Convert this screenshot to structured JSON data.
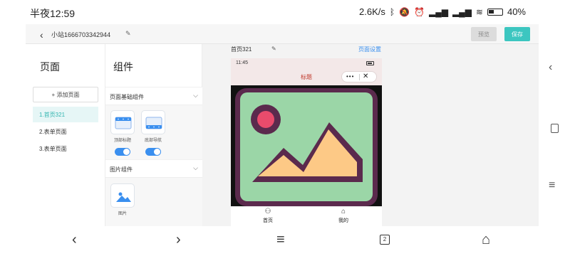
{
  "status_bar": {
    "time": "半夜12:59",
    "network_speed": "2.6K/s",
    "battery": "40%"
  },
  "topbar": {
    "site_name": "小站1666703342944",
    "preview_label": "预览",
    "save_label": "保存"
  },
  "pages_panel": {
    "title": "页面",
    "add_label": "+ 添加页面",
    "pages": [
      {
        "label": "1.首页321",
        "active": true
      },
      {
        "label": "2.表单页面",
        "active": false
      },
      {
        "label": "3.表单页面",
        "active": false
      }
    ]
  },
  "components_panel": {
    "title": "组件",
    "groups": [
      {
        "label": "页面基础组件",
        "items": [
          "顶部标题",
          "底部导航"
        ]
      },
      {
        "label": "图片组件",
        "items": [
          "图片"
        ]
      }
    ]
  },
  "canvas": {
    "page_name": "首页321",
    "page_settings": "页面设置",
    "phone": {
      "time": "11:45",
      "title": "标题",
      "tabs": [
        "首页",
        "我的"
      ]
    }
  },
  "colors": {
    "accent": "#3cc6c0",
    "link": "#3a8fef",
    "title_red": "#c0392b"
  }
}
